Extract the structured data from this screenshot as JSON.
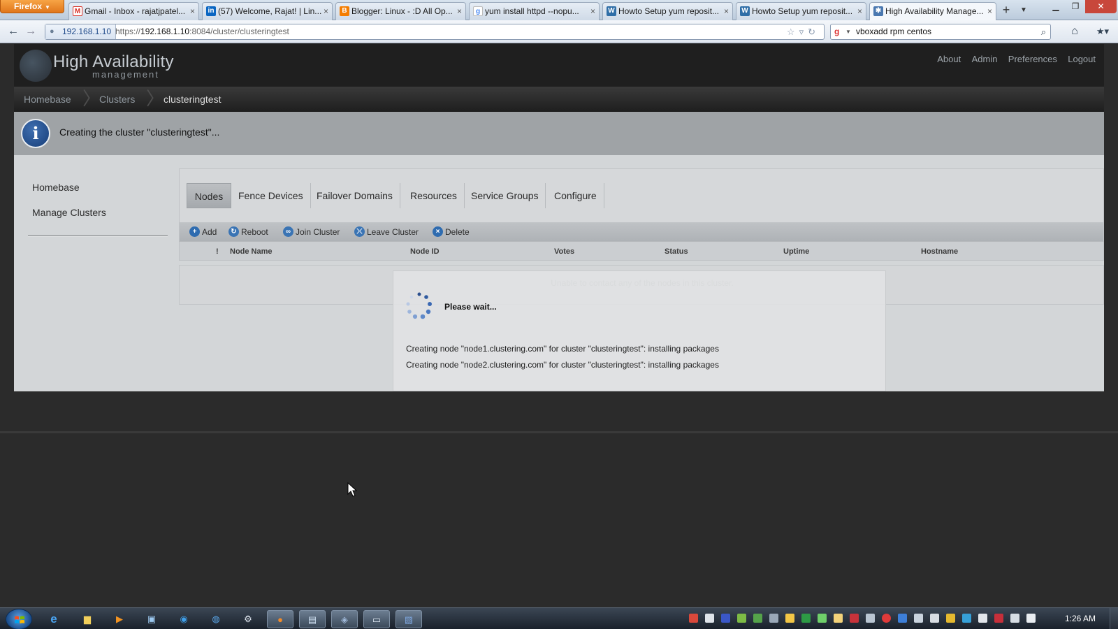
{
  "browser": {
    "menu_label": "Firefox",
    "tabs": [
      {
        "title": "Gmail - Inbox - rajatjpatel...",
        "icon": "gmail-icon",
        "color": "#d93025"
      },
      {
        "title": "(57) Welcome, Rajat! | Lin...",
        "icon": "linkedin-icon",
        "color": "#0a66c2"
      },
      {
        "title": "Blogger: Linux - :D All Op...",
        "icon": "blogger-icon",
        "color": "#f57d00"
      },
      {
        "title": "yum install httpd --nopu...",
        "icon": "google-icon",
        "color": "#4285f4"
      },
      {
        "title": "Howto Setup yum reposit...",
        "icon": "wordpress-icon",
        "color": "#2f6ea7"
      },
      {
        "title": "Howto Setup yum reposit...",
        "icon": "wordpress-icon",
        "color": "#2f6ea7"
      },
      {
        "title": "High Availability Manage...",
        "icon": "ha-icon",
        "color": "#4a78b0"
      }
    ],
    "identity": "192.168.1.10",
    "url_prefix": "https://",
    "url_host": "192.168.1.10",
    "url_path": ":8084/cluster/clusteringtest",
    "search_value": "vboxadd rpm centos"
  },
  "app": {
    "title": "High Availability",
    "subtitle": "management",
    "top_links": [
      "About",
      "Admin",
      "Preferences",
      "Logout"
    ],
    "breadcrumb": [
      "Homebase",
      "Clusters",
      "clusteringtest"
    ],
    "notice": "Creating the cluster \"clusteringtest\"...",
    "sidebar": [
      "Homebase",
      "Manage Clusters"
    ],
    "tabs": [
      "Nodes",
      "Fence Devices",
      "Failover Domains",
      "Resources",
      "Service Groups",
      "Configure"
    ],
    "toolbar": [
      "Add",
      "Reboot",
      "Join Cluster",
      "Leave Cluster",
      "Delete"
    ],
    "columns": [
      "!",
      "Node Name",
      "Node ID",
      "Votes",
      "Status",
      "Uptime",
      "Hostname"
    ],
    "empty_message": "Unable to contact any of the nodes in this cluster."
  },
  "modal": {
    "title": "Please wait...",
    "lines": [
      "Creating node \"node1.clustering.com\" for cluster \"clusteringtest\": installing packages",
      "Creating node \"node2.clustering.com\" for cluster \"clusteringtest\": installing packages"
    ]
  },
  "taskbar": {
    "clock": "1:26 AM"
  }
}
